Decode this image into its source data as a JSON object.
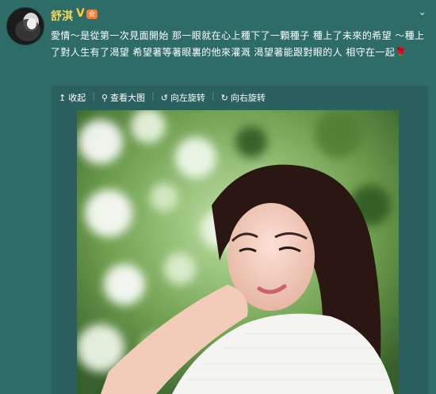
{
  "post": {
    "author": "舒淇",
    "verified_badge": "V",
    "member_badge": "会",
    "close_glyph": "⌄",
    "text": "愛情～是從第一次見面開始 那一眼就在心上種下了一顆種子 種上了未來的希望 ～種上了對人生有了渴望 希望著等著眼裏的他來灌溉 渴望著能跟對眼的人 相守在一起",
    "emoji": "🌹"
  },
  "toolbar": {
    "collapse": "收起",
    "view_large": "查看大图",
    "rotate_left": "向左旋转",
    "rotate_right": "向右旋转"
  },
  "icons": {
    "collapse": "arrow-up-icon",
    "view_large": "magnifier-icon",
    "rotate_left": "rotate-left-icon",
    "rotate_right": "rotate-right-icon"
  },
  "colors": {
    "background": "#2e6c68",
    "username": "#f2d35e",
    "text": "#ffffff"
  }
}
